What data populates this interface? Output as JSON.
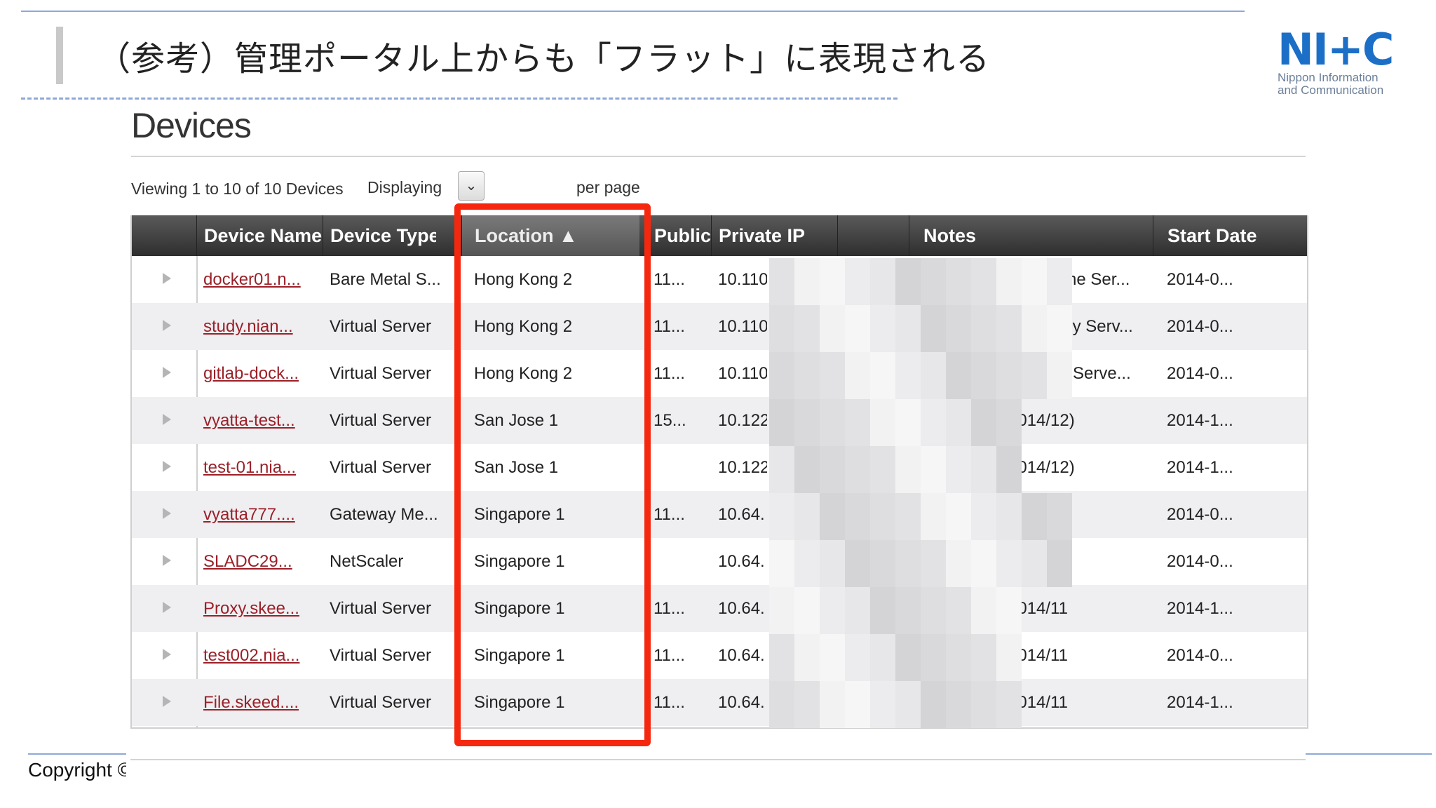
{
  "slide": {
    "title": "（参考）管理ポータル上からも「フラット」に表現される",
    "copyright": "Copyright ©"
  },
  "logo": {
    "mark": "NI+C",
    "line1": "Nippon Information",
    "line2": "and Communication"
  },
  "devices": {
    "heading": "Devices",
    "viewing": "Viewing 1 to 10 of 10 Devices",
    "displaying": "Displaying",
    "per_page_select_icon": "chevron-down-icon",
    "per_page": "per page"
  },
  "table": {
    "columns": [
      "Device Name",
      "Device Type",
      "Location ▲",
      "Public",
      "Private IP",
      "Notes",
      "Start Date"
    ],
    "sorted_column": "Location",
    "rows": [
      {
        "name": "docker01.n...",
        "type": "Bare Metal S...",
        "location": "Hong Kong 2",
        "public": "11...",
        "private": "10.110",
        "notes": "- Redmine Ser...",
        "start": "2014-0..."
      },
      {
        "name": "study.nian...",
        "type": "Virtual Server",
        "location": "Hong Kong 2",
        "public": "11...",
        "private": "10.110",
        "notes": "- IT Study Serv...",
        "start": "2014-0..."
      },
      {
        "name": "gitlab-dock...",
        "type": "Virtual Server",
        "location": "Hong Kong 2",
        "public": "11...",
        "private": "10.110",
        "notes": "- GitLab Serve...",
        "start": "2014-0..."
      },
      {
        "name": "vyatta-test...",
        "type": "Virtual Server",
        "location": "San Jose 1",
        "public": "15...",
        "private": "10.122",
        "notes": "2014/12)",
        "start": "2014-1..."
      },
      {
        "name": "test-01.nia...",
        "type": "Virtual Server",
        "location": "San Jose 1",
        "public": "",
        "private": "10.122",
        "notes": "2014/12)",
        "start": "2014-1..."
      },
      {
        "name": "vyatta777....",
        "type": "Gateway Me...",
        "location": "Singapore 1",
        "public": "11...",
        "private": "10.64.",
        "notes": "",
        "start": "2014-0..."
      },
      {
        "name": "SLADC29...",
        "type": "NetScaler",
        "location": "Singapore 1",
        "public": "",
        "private": "10.64.",
        "notes": "",
        "start": "2014-0..."
      },
      {
        "name": "Proxy.skee...",
        "type": "Virtual Server",
        "location": "Singapore 1",
        "public": "11...",
        "private": "10.64.",
        "notes": "2014/11",
        "start": "2014-1..."
      },
      {
        "name": "test002.nia...",
        "type": "Virtual Server",
        "location": "Singapore 1",
        "public": "11...",
        "private": "10.64.",
        "notes": "2014/11",
        "start": "2014-0..."
      },
      {
        "name": "File.skeed....",
        "type": "Virtual Server",
        "location": "Singapore 1",
        "public": "11...",
        "private": "10.64.",
        "notes": "2014/11",
        "start": "2014-1..."
      }
    ]
  },
  "colors": {
    "highlight": "#f5280f",
    "link": "#9b2028",
    "accent_line": "#8fa9d6"
  }
}
